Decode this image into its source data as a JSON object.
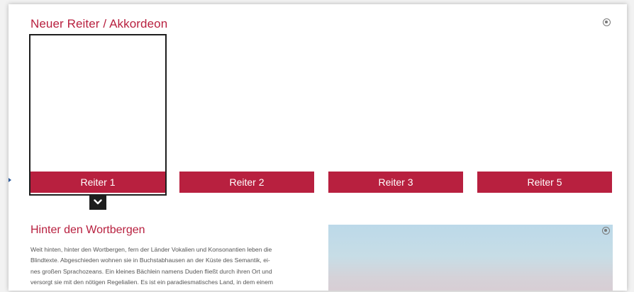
{
  "section": {
    "title": "Neuer Reiter / Akkordeon"
  },
  "tabs": [
    {
      "label": "Reiter 1",
      "active": true
    },
    {
      "label": "Reiter 2",
      "active": false
    },
    {
      "label": "Reiter 3",
      "active": false
    },
    {
      "label": "Reiter 5",
      "active": false
    }
  ],
  "content": {
    "heading": "Hinter den Wortbergen",
    "lines": [
      "Weit hinten, hinter den Wortbergen, fern der Länder Vokalien und Konsonantien leben die",
      "Blindtexte. Abgeschieden wohnen sie in Buchstabhausen an der Küste des Semantik, ei-",
      "nes großen Sprachozeans. Ein kleines Bächlein namens Duden fließt durch ihren Ort und",
      "versorgt sie mit den nötigen Regelialien. Es ist ein paradiesmatisches Land, in dem einem"
    ]
  },
  "icons": {
    "settings_top": "settings-icon",
    "settings_image": "settings-icon",
    "expand": "chevron-down-icon",
    "marker": "arrow-right-icon"
  },
  "colors": {
    "accent": "#b8203f",
    "dark": "#1e1e1e",
    "text": "#555555"
  }
}
